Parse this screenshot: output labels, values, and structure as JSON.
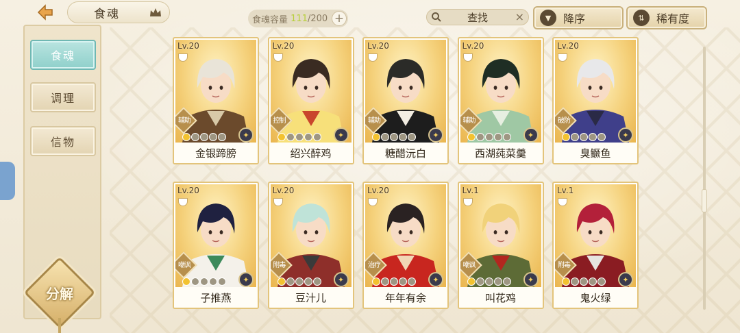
{
  "header": {
    "title": "食魂",
    "capacity_label": "食魂容量",
    "capacity_current": "111",
    "capacity_max": "/200",
    "capacity_add": "+",
    "search_placeholder": "查找",
    "search_clear": "×",
    "sort_order_label": "降序",
    "sort_key_label": "稀有度"
  },
  "sidebar": {
    "items": [
      {
        "label": "食魂",
        "active": true
      },
      {
        "label": "调理",
        "active": false
      },
      {
        "label": "信物",
        "active": false
      }
    ],
    "decompose_label": "分解"
  },
  "cards": [
    {
      "level": "Lv.20",
      "name": "金银蹄膀",
      "role": "辅助",
      "stars": 5,
      "lit": 1,
      "hair": "#e9e4d8",
      "outfit": "#6b4a2c",
      "accent": "#d8c9a8"
    },
    {
      "level": "Lv.20",
      "name": "绍兴醉鸡",
      "role": "控制",
      "stars": 5,
      "lit": 1,
      "hair": "#3a2b22",
      "outfit": "#f7e07a",
      "accent": "#c9462c"
    },
    {
      "level": "Lv.20",
      "name": "糖醋沅白",
      "role": "辅助",
      "stars": 5,
      "lit": 1,
      "hair": "#2b2b28",
      "outfit": "#1d1d1d",
      "accent": "#f2ede2"
    },
    {
      "level": "Lv.20",
      "name": "西湖莼菜羹",
      "role": "辅助",
      "stars": 5,
      "lit": 1,
      "hair": "#1f2e24",
      "outfit": "#9fc8a4",
      "accent": "#e7efe1"
    },
    {
      "level": "Lv.20",
      "name": "臭鳜鱼",
      "role": "破防",
      "stars": 5,
      "lit": 1,
      "hair": "#e8e8ea",
      "outfit": "#3f3f8a",
      "accent": "#2a2a46"
    },
    {
      "level": "Lv.20",
      "name": "子推燕",
      "role": "嘲讽",
      "stars": 5,
      "lit": 1,
      "hair": "#1f2140",
      "outfit": "#f4f1ea",
      "accent": "#3c8a5b"
    },
    {
      "level": "Lv.20",
      "name": "豆汁儿",
      "role": "附毒",
      "stars": 5,
      "lit": 1,
      "hair": "#bfe3d8",
      "outfit": "#8e2f2a",
      "accent": "#3a3a3a"
    },
    {
      "level": "Lv.20",
      "name": "年年有余",
      "role": "治疗",
      "stars": 5,
      "lit": 1,
      "hair": "#2a2222",
      "outfit": "#c8261f",
      "accent": "#f1d7b6"
    },
    {
      "level": "Lv.1",
      "name": "叫花鸡",
      "role": "嘲讽",
      "stars": 5,
      "lit": 1,
      "hair": "#f1d27a",
      "outfit": "#5d6b36",
      "accent": "#b3261f"
    },
    {
      "level": "Lv.1",
      "name": "鬼火绿",
      "role": "附毒",
      "stars": 5,
      "lit": 1,
      "hair": "#b3203a",
      "outfit": "#8a1c22",
      "accent": "#e6e4e0"
    }
  ]
}
